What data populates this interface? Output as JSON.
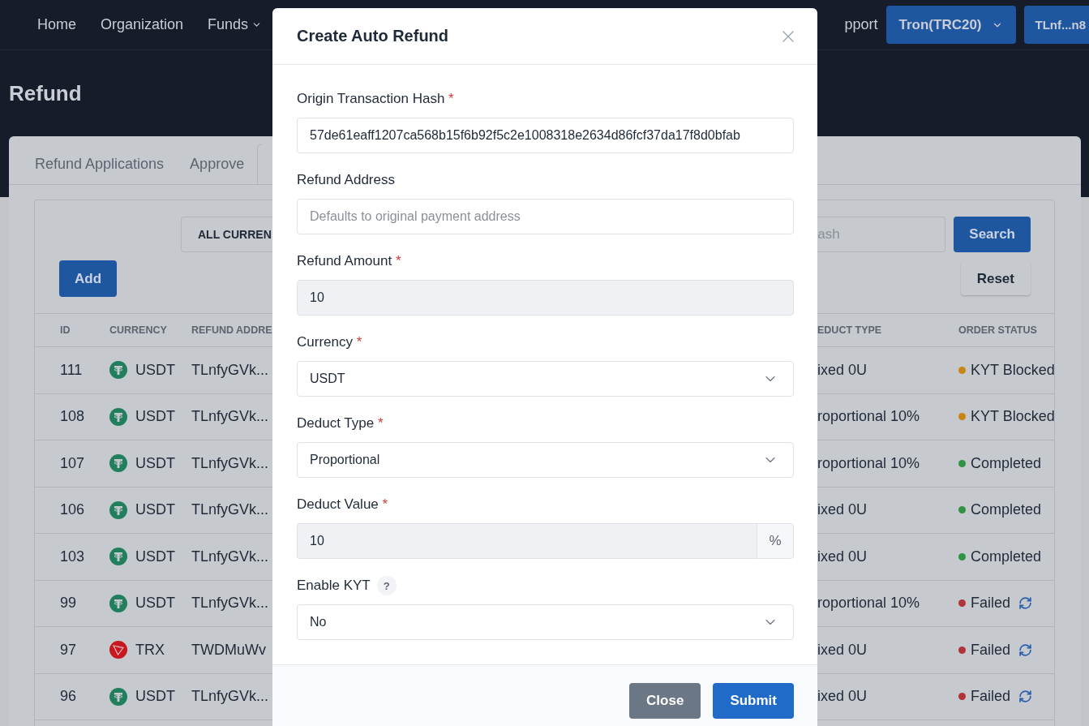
{
  "nav": {
    "items": [
      {
        "label": "Home",
        "dropdown": false
      },
      {
        "label": "Organization",
        "dropdown": false
      },
      {
        "label": "Funds",
        "dropdown": true
      }
    ],
    "cut_item": "pport",
    "network_button": "Tron(TRC20)",
    "wallet_button": "TLnf...n8"
  },
  "page_title": "Refund",
  "tabs": [
    {
      "label": "Refund Applications",
      "selected": false
    },
    {
      "label": "Approve",
      "selected": false
    }
  ],
  "filters": {
    "currency_select": "ALL CURREN",
    "search_placeholder": "ash",
    "search_button": "Search",
    "reset_button": "Reset",
    "add_button": "Add"
  },
  "table": {
    "columns_left": [
      "ID",
      "CURRENCY",
      "REFUND ADDRE"
    ],
    "columns_right": [
      "EDUCT TYPE",
      "ORDER STATUS"
    ],
    "rows": [
      {
        "id": "111",
        "currency": "USDT",
        "kind": "usdt",
        "address": "TLnfyGVk...",
        "deduct": "ixed 0U",
        "status": "KYT Blocked",
        "color": "#c98512",
        "retry": false
      },
      {
        "id": "108",
        "currency": "USDT",
        "kind": "usdt",
        "address": "TLnfyGVk...",
        "deduct": "roportional 10%",
        "status": "KYT Blocked",
        "color": "#c98512",
        "retry": false
      },
      {
        "id": "107",
        "currency": "USDT",
        "kind": "usdt",
        "address": "TLnfyGVk...",
        "deduct": "roportional 10%",
        "status": "Completed",
        "color": "#2e9443",
        "retry": false
      },
      {
        "id": "106",
        "currency": "USDT",
        "kind": "usdt",
        "address": "TLnfyGVk...",
        "deduct": "ixed 0U",
        "status": "Completed",
        "color": "#2e9443",
        "retry": false
      },
      {
        "id": "103",
        "currency": "USDT",
        "kind": "usdt",
        "address": "TLnfyGVk...",
        "deduct": "ixed 0U",
        "status": "Completed",
        "color": "#2e9443",
        "retry": false
      },
      {
        "id": "99",
        "currency": "USDT",
        "kind": "usdt",
        "address": "TLnfyGVk...",
        "deduct": "roportional 10%",
        "status": "Failed",
        "color": "#b0343a",
        "retry": true
      },
      {
        "id": "97",
        "currency": "TRX",
        "kind": "trx",
        "address": "TWDMuWv",
        "deduct": "ixed 0U",
        "status": "Failed",
        "color": "#b0343a",
        "retry": true
      },
      {
        "id": "96",
        "currency": "USDT",
        "kind": "usdt",
        "address": "TLnfyGVk...",
        "deduct": "ixed 0U",
        "status": "Failed",
        "color": "#b0343a",
        "retry": true
      }
    ]
  },
  "modal": {
    "title": "Create Auto Refund",
    "fields": [
      {
        "kind": "text",
        "label": "Origin Transaction Hash",
        "required_mark": "*",
        "value": "57de61eaff1207ca568b15f6b92f5c2e1008318e2634d86fcf37da17f8d0bfab",
        "readonly": false,
        "help": false
      },
      {
        "kind": "text",
        "label": "Refund Address",
        "placeholder": "Defaults to original payment address",
        "readonly": false,
        "help": false
      },
      {
        "kind": "text",
        "label": "Refund Amount",
        "required_mark": "*",
        "value": "10",
        "readonly": true,
        "help": false
      },
      {
        "kind": "select",
        "label": "Currency",
        "required_mark": "*",
        "value": "USDT",
        "readonly": false,
        "help": false
      },
      {
        "kind": "select",
        "label": "Deduct Type",
        "required_mark": "*",
        "value": "Proportional",
        "readonly": false,
        "help": false
      },
      {
        "kind": "addon",
        "label": "Deduct Value",
        "required_mark": "*",
        "value": "10",
        "suffix": "%",
        "readonly": true,
        "help": false
      },
      {
        "kind": "select",
        "label": "Enable KYT",
        "value": "No",
        "readonly": false,
        "help": true,
        "help_mark": "?"
      }
    ],
    "buttons": [
      {
        "label": "Close",
        "kind": "secondary"
      },
      {
        "label": "Submit",
        "kind": "primary"
      }
    ]
  }
}
